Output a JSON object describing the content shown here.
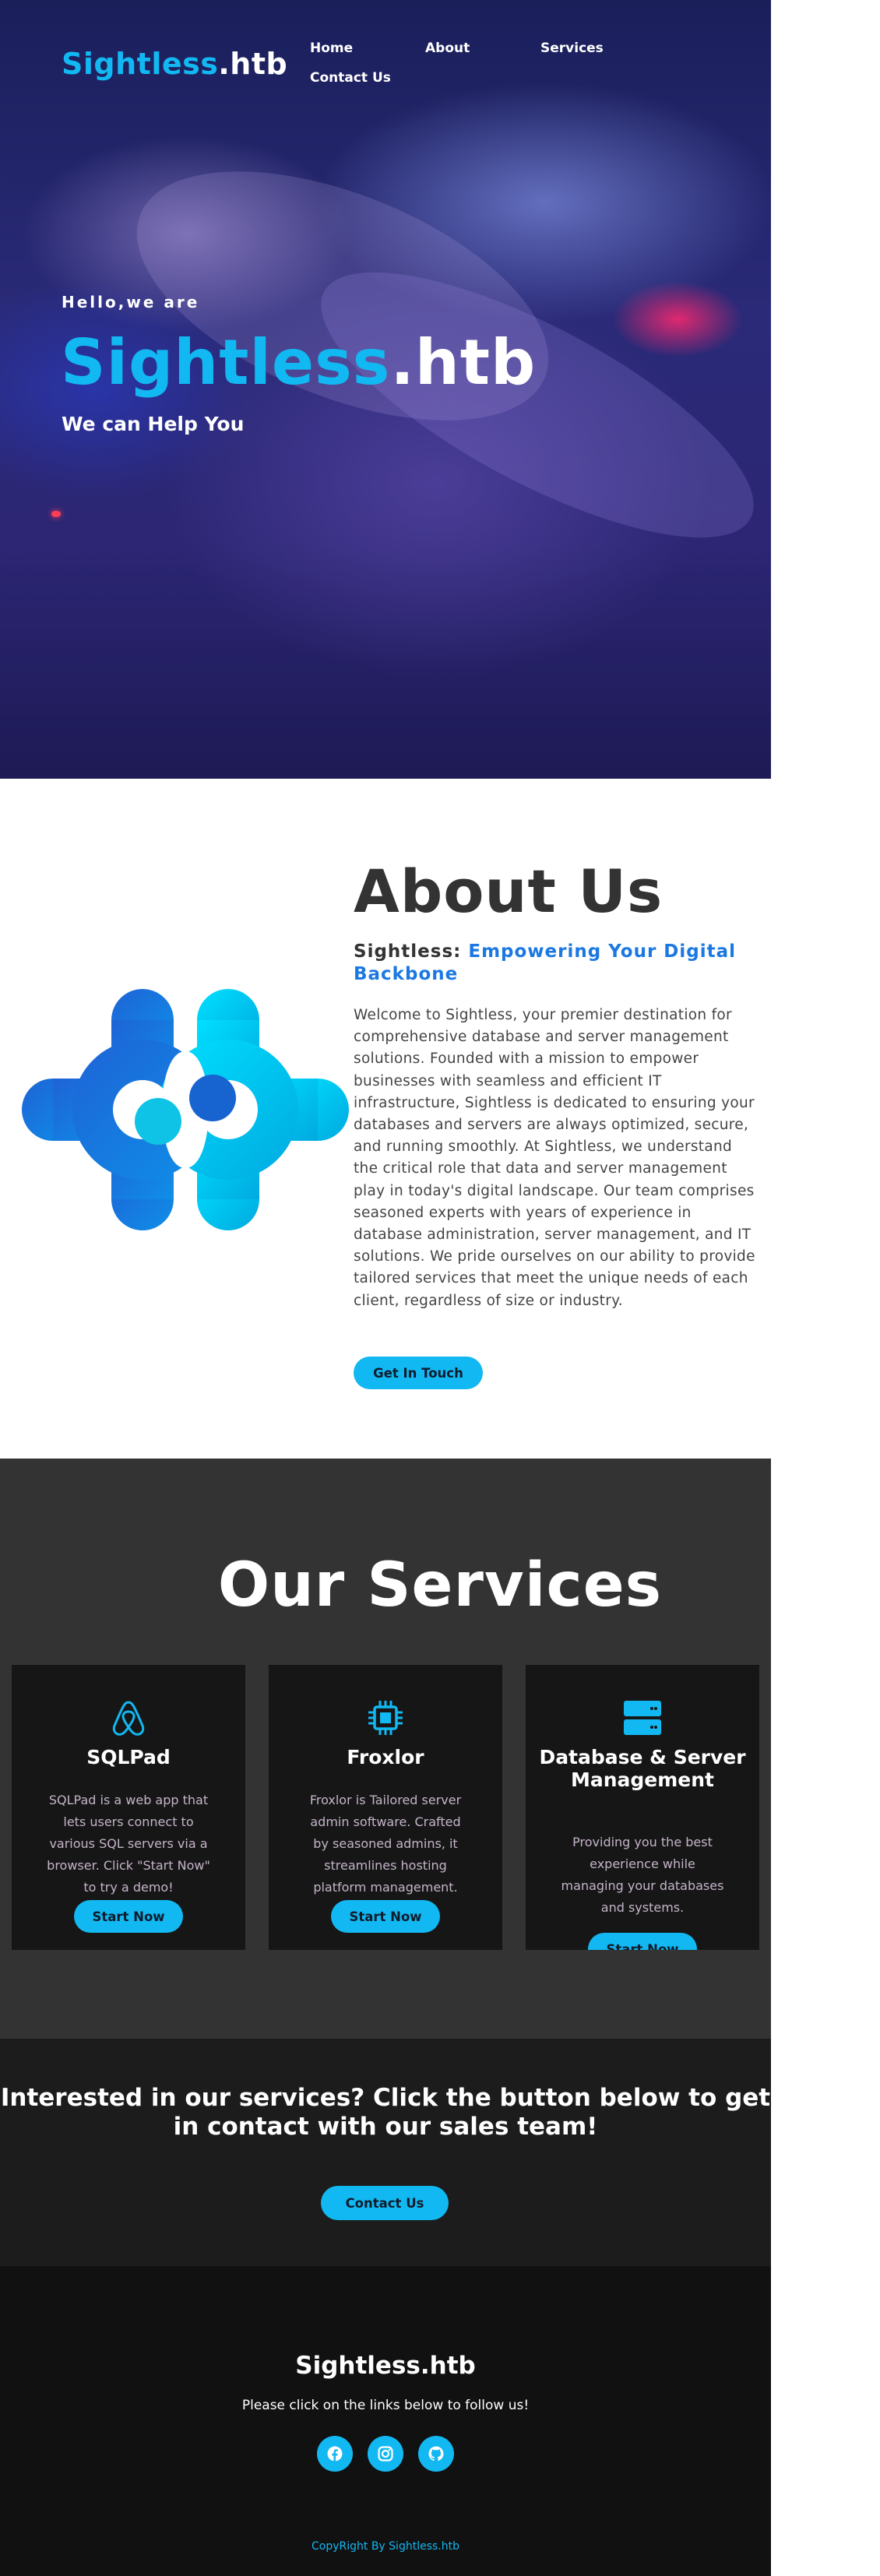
{
  "colors": {
    "accent": "#12b8f2",
    "about_subtitle_blue": "#1b78e2",
    "services_bg": "#333333",
    "card_bg": "#161616",
    "footer_bg": "#111111"
  },
  "header": {
    "brand_prefix": "Sightless",
    "brand_suffix": ".htb",
    "nav": [
      {
        "label": "Home"
      },
      {
        "label": "About"
      },
      {
        "label": "Services"
      },
      {
        "label": "Contact Us"
      }
    ]
  },
  "hero": {
    "greeting": "Hello,we are",
    "title_prefix": "Sightless",
    "title_suffix": ".htb",
    "subtitle": "We can Help You"
  },
  "about": {
    "title": "About Us",
    "subtitle_prefix": "Sightless:",
    "subtitle_highlight": "Empowering Your Digital Backbone",
    "body": "Welcome to Sightless, your premier destination for comprehensive database and server management solutions. Founded with a mission to empower businesses with seamless and efficient IT infrastructure, Sightless is dedicated to ensuring your databases and servers are always optimized, secure, and running smoothly. At Sightless, we understand the critical role that data and server management play in today's digital landscape. Our team comprises seasoned experts with years of experience in database administration, server management, and IT solutions. We pride ourselves on our ability to provide tailored services that meet the unique needs of each client, regardless of size or industry.",
    "button": "Get In Touch",
    "logo_icon": "sightless-logo-icon"
  },
  "services": {
    "title": "Our Services",
    "cards": [
      {
        "icon": "airbnb-icon",
        "title": "SQLPad",
        "description": "SQLPad is a web app that lets users connect to various SQL servers via a browser. Click \"Start Now\" to try a demo!",
        "button": "Start Now"
      },
      {
        "icon": "cpu-chip-icon",
        "title": "Froxlor",
        "description": "Froxlor is Tailored server admin software. Crafted by seasoned admins, it streamlines hosting platform management.",
        "button": "Start Now"
      },
      {
        "icon": "server-icon",
        "title": "Database & Server Management",
        "description": "Providing you the best experience while managing your databases and systems.",
        "button": "Start Now"
      }
    ]
  },
  "cta": {
    "text": "Interested in our services? Click the button below to get in contact with our sales team!",
    "button": "Contact Us"
  },
  "footer": {
    "brand": "Sightless.htb",
    "tagline": "Please click on the links below to follow us!",
    "social": [
      "facebook-icon",
      "instagram-icon",
      "github-icon"
    ],
    "copyright": "CopyRight By Sightless.htb"
  }
}
